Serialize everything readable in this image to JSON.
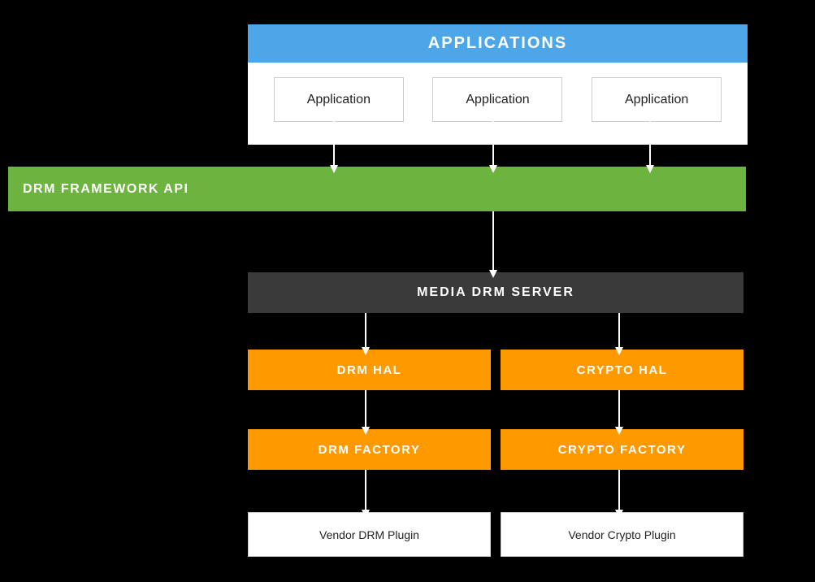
{
  "applications": {
    "header": "APPLICATIONS",
    "boxes": [
      {
        "label": "Application"
      },
      {
        "label": "Application"
      },
      {
        "label": "Application"
      }
    ]
  },
  "drm_framework": {
    "label": "DRM FRAMEWORK API"
  },
  "media_drm_server": {
    "label": "MEDIA DRM SERVER"
  },
  "hal_row": {
    "left": "DRM HAL",
    "right": "CRYPTO HAL"
  },
  "factory_row": {
    "left": "DRM FACTORY",
    "right": "CRYPTO FACTORY"
  },
  "vendor_row": {
    "left": "Vendor DRM Plugin",
    "right": "Vendor Crypto Plugin"
  },
  "colors": {
    "blue": "#4DA6E8",
    "green": "#6DB33F",
    "orange": "#FF9900",
    "dark": "#3a3a3a",
    "white": "#ffffff",
    "black": "#000000"
  }
}
